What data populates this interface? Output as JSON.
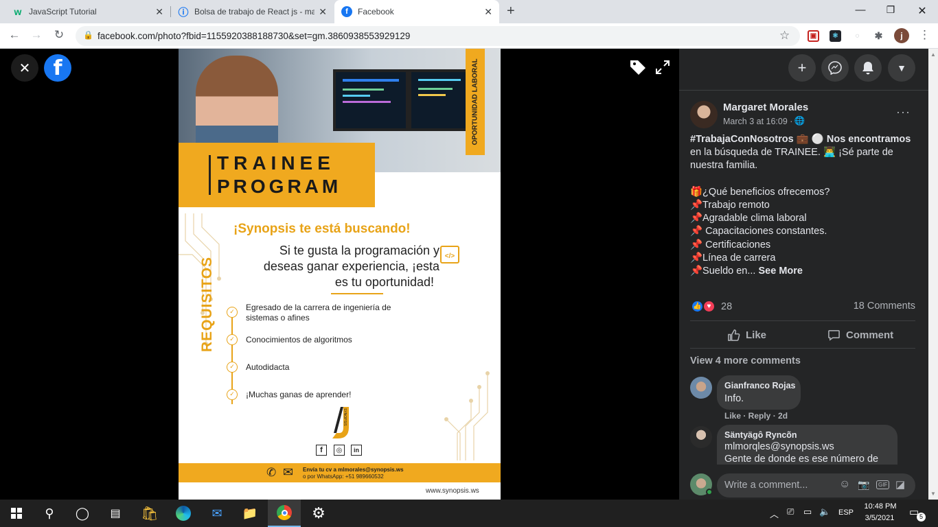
{
  "browser": {
    "tabs": [
      {
        "title": "JavaScript Tutorial",
        "icon": "w3schools-icon"
      },
      {
        "title": "Bolsa de trabajo de React js - ma",
        "icon": "page-icon"
      },
      {
        "title": "Facebook",
        "icon": "facebook-icon",
        "active": true
      }
    ],
    "new_tab": "+",
    "url": "facebook.com/photo?fbid=1155920388188730&set=gm.3860938553929129",
    "profile_initial": "j"
  },
  "poster": {
    "side_label": "OPORTUNIDAD LABORAL",
    "headline_1": "TRAINEE",
    "headline_2": "PROGRAM",
    "tagline": "¡Synopsis te está buscando!",
    "intro_1": "Si te gusta la programación y",
    "intro_2": "deseas ganar experiencia, ¡esta",
    "intro_3": "es tu oportunidad!",
    "requirements_title": "REQUISITOS",
    "requirements": [
      "Egresado de la carrera de ingeniería de",
      "sistemas o afines",
      "Conocimientos de algoritmos",
      "Autodidacta",
      "¡Muchas ganas de aprender!"
    ],
    "brand": "SYNOPSIS",
    "social": [
      "f",
      "◎",
      "in"
    ],
    "contact_1": "Envía tu cv a mlmorales@synopsis.ws",
    "contact_2": "o por WhatsApp: +51 989660532",
    "website": "www.synopsis.ws",
    "code_icon": "</>"
  },
  "post": {
    "author": "Margaret Morales",
    "date": "March 3 at 16:09 · ",
    "more": "···",
    "body": [
      "#TrabajaConNosotros 💼 ⚪  Nos encontramos",
      "en la búsqueda de TRAINEE. 👨‍💻 ¡Sé parte de",
      "nuestra familia.",
      "",
      "🎁¿Qué beneficios ofrecemos?",
      "📌Trabajo remoto",
      "📌Agradable clima laboral",
      "📌 Capacitaciones constantes.",
      "📌 Certificaciones",
      "📌Línea de carrera",
      "📌Sueldo en... "
    ],
    "see_more": "See More",
    "reactions_count": "28",
    "comments_count": "18 Comments",
    "like_label": "Like",
    "comment_label": "Comment",
    "view_more": "View 4 more comments",
    "comments": [
      {
        "name": "Gianfranco Rojas",
        "text": "Info.",
        "actions": "Like · Reply · 2d"
      },
      {
        "name": "Säntyägô Ryncõn",
        "text": "mlmorqles@synopsis.ws",
        "text2": "Gente de donde es ese número de"
      }
    ],
    "write_placeholder": "Write a comment..."
  },
  "taskbar": {
    "lang": "ESP",
    "time": "10:48 PM",
    "date": "3/5/2021",
    "notifications": "5"
  },
  "colors": {
    "accent": "#f0a91f",
    "fb_blue": "#1877f2",
    "panel": "#242526"
  }
}
